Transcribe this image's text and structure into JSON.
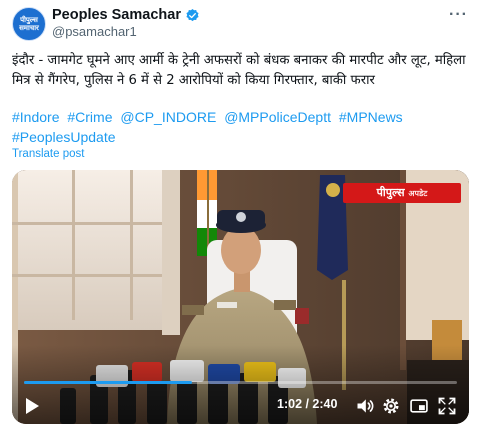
{
  "author": {
    "display_name": "Peoples Samachar",
    "handle": "@psamachar1",
    "avatar_line1": "पीपुल्स",
    "avatar_line2": "समाचार"
  },
  "post": {
    "text": "इंदौर - जामगेट घूमने आए आर्मी के ट्रेनी अफसरों को बंधक बनाकर की मारपीट और लूट, महिला मित्र से गैंगरेप, पुलिस ने 6 में से 2 आरोपियों को किया गिरफ्तार, बाकी फरार",
    "tags": [
      "#Indore",
      "#Crime",
      "@CP_INDORE",
      "@MPPoliceDeptt",
      "#MPNews",
      "#PeoplesUpdate"
    ],
    "translate_label": "Translate post"
  },
  "video": {
    "watermark_main": "पीपुल्स",
    "watermark_sub": "अपडेट",
    "time_label": "1:02 / 2:40",
    "progress": 0.3875
  },
  "icons": {
    "more": "more-icon",
    "verified": "verified-badge-icon",
    "play": "play-icon",
    "volume": "volume-icon",
    "settings": "gear-icon",
    "fullscreen": "fullscreen-icon"
  },
  "colors": {
    "link": "#1d9bf0",
    "verified": "#1d9bf0",
    "watermark": "#d41818"
  }
}
